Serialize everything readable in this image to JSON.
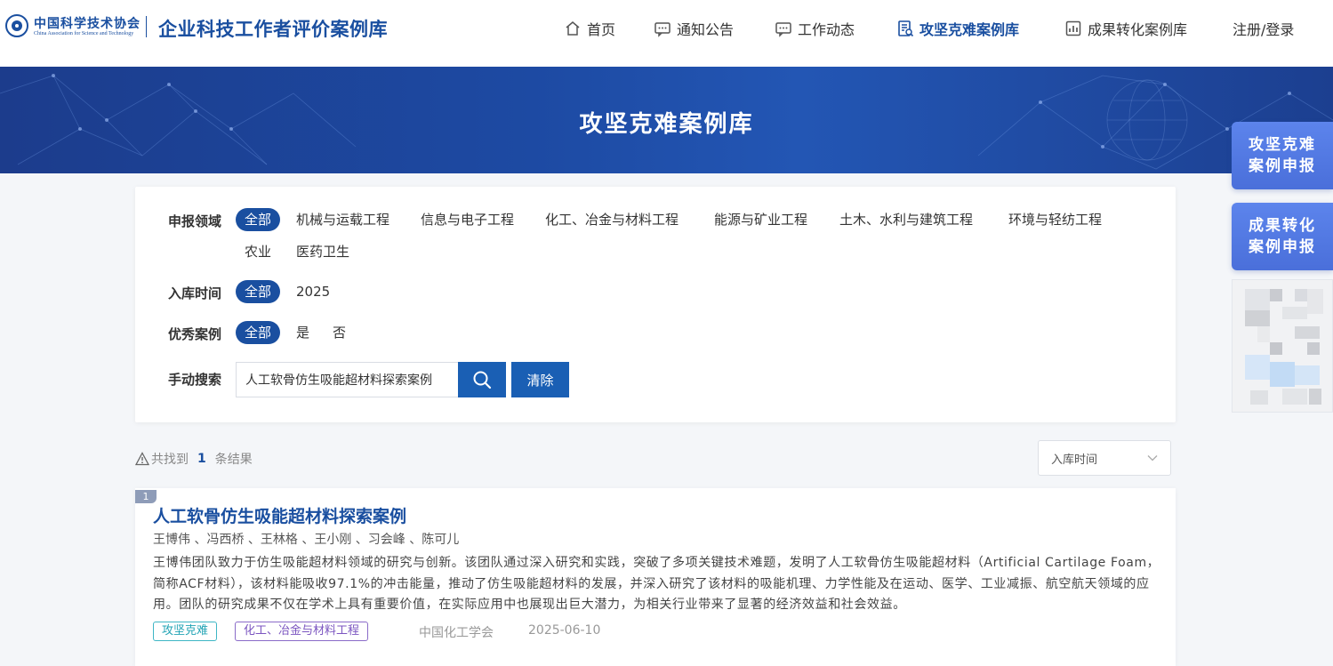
{
  "header": {
    "logo_cn": "中国科学技术协会",
    "logo_en": "China Association for Science and Technology",
    "site_title": "企业科技工作者评价案例库",
    "nav": [
      {
        "label": "首页",
        "icon": "home-icon"
      },
      {
        "label": "通知公告",
        "icon": "message-icon"
      },
      {
        "label": "工作动态",
        "icon": "chat-icon"
      },
      {
        "label": "攻坚克难案例库",
        "icon": "document-icon",
        "active": true
      },
      {
        "label": "成果转化案例库",
        "icon": "chart-icon"
      }
    ],
    "login": "注册/登录"
  },
  "banner": {
    "title": "攻坚克难案例库"
  },
  "side": {
    "btn1_line1": "攻坚克难",
    "btn1_line2": "案例申报",
    "btn2_line1": "成果转化",
    "btn2_line2": "案例申报"
  },
  "filters": {
    "field_label": "申报领域",
    "field_options": [
      "全部",
      "机械与运载工程",
      "信息与电子工程",
      "化工、冶金与材料工程",
      "能源与矿业工程",
      "土木、水利与建筑工程",
      "环境与轻纺工程",
      "农业",
      "医药卫生"
    ],
    "time_label": "入库时间",
    "time_options": [
      "全部",
      "2025"
    ],
    "excellent_label": "优秀案例",
    "excellent_options": [
      "全部",
      "是",
      "否"
    ],
    "search_label": "手动搜索",
    "search_value": "人工软骨仿生吸能超材料探索案例",
    "clear_label": "清除"
  },
  "results": {
    "prefix": "共找到",
    "count": "1",
    "suffix": "条结果",
    "sort_value": "入库时间"
  },
  "items": [
    {
      "index": "1",
      "title": "人工软骨仿生吸能超材料探索案例",
      "authors": "王博伟 、冯西桥 、王林格 、王小刚 、习会峰 、陈可儿",
      "description": "王博伟团队致力于仿生吸能超材料领域的研究与创新。该团队通过深入研究和实践，突破了多项关键技术难题，发明了人工软骨仿生吸能超材料（Artificial Cartilage Foam，简称ACF材料），该材料能吸收97.1%的冲击能量，推动了仿生吸能超材料的发展，并深入研究了该材料的吸能机理、力学性能及在运动、医学、工业减振、航空航天领域的应用。团队的研究成果不仅在学术上具有重要价值，在实际应用中也展现出巨大潜力，为相关行业带来了显著的经济效益和社会效益。",
      "tag1": "攻坚克难",
      "tag2": "化工、冶金与材料工程",
      "org": "中国化工学会",
      "date": "2025-06-10"
    }
  ],
  "colors": {
    "primary": "#1a4fa0",
    "banner": "#1d4aa3",
    "side_button": "#5278e2"
  }
}
